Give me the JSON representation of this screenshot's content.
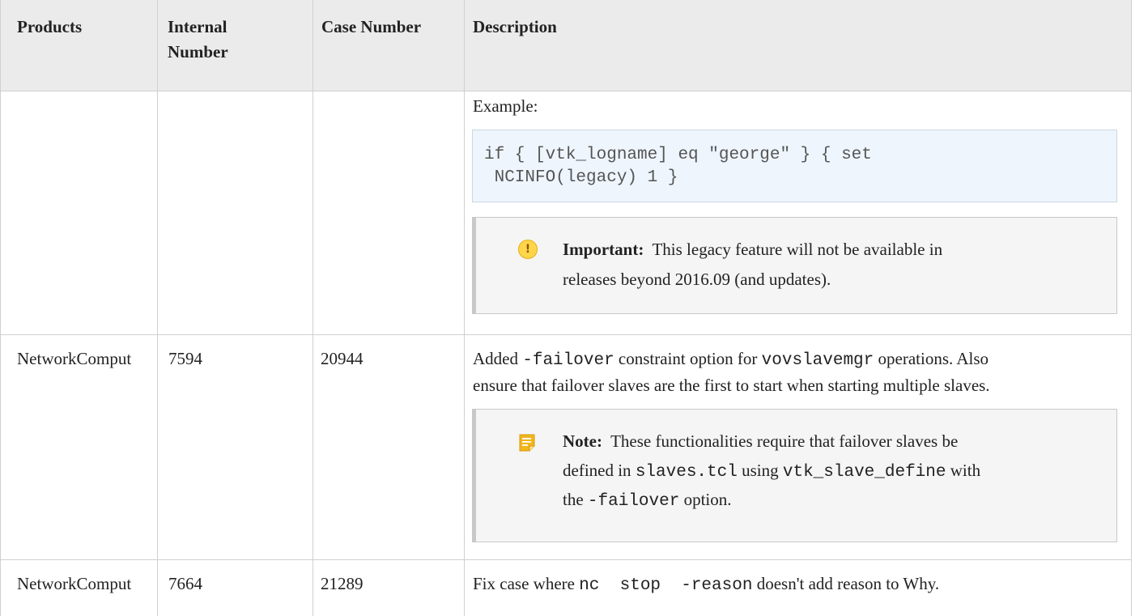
{
  "table": {
    "headers": {
      "products": "Products",
      "internal_number_line1": "Internal",
      "internal_number_line2": "Number",
      "case_number": "Case Number",
      "description": "Description"
    },
    "row1": {
      "example_label": "Example:",
      "code_line1": "if { [vtk_logname] eq \"george\" } { set",
      "code_line2": " NCINFO(legacy) 1 }",
      "important_label": "Important:",
      "important_text_line1": "This legacy feature will not be available in",
      "important_text_line2": "releases beyond 2016.09 (and updates)."
    },
    "row2": {
      "product": "NetworkComput",
      "internal_number": "7594",
      "case_number": "20944",
      "desc_part1": "Added ",
      "desc_code1": "-failover",
      "desc_part2": " constraint option for ",
      "desc_code2": "vovslavemgr",
      "desc_part3": " operations. Also",
      "desc_line2": "ensure that failover slaves are the first to start when starting multiple slaves.",
      "note_label": "Note:",
      "note_line1": "These functionalities require that failover slaves be",
      "note_line2_part1": "defined in ",
      "note_line2_code1": "slaves.tcl",
      "note_line2_part2": " using ",
      "note_line2_code2": "vtk_slave_define",
      "note_line2_part3": " with",
      "note_line3_part1": "the ",
      "note_line3_code": "-failover",
      "note_line3_part2": " option."
    },
    "row3": {
      "product": "NetworkComput",
      "internal_number": "7664",
      "case_number": "21289",
      "desc_part1": "Fix case where ",
      "desc_code": "nc  stop  -reason",
      "desc_part2": " doesn't add reason to Why."
    }
  },
  "colors": {
    "header_background": "#ebebeb",
    "code_background": "#eef5fd",
    "notice_background": "#f5f5f5",
    "warning_icon": "#ffd54a",
    "note_icon": "#f0b61e"
  },
  "icons": {
    "important": "warning-icon",
    "note": "note-icon"
  }
}
